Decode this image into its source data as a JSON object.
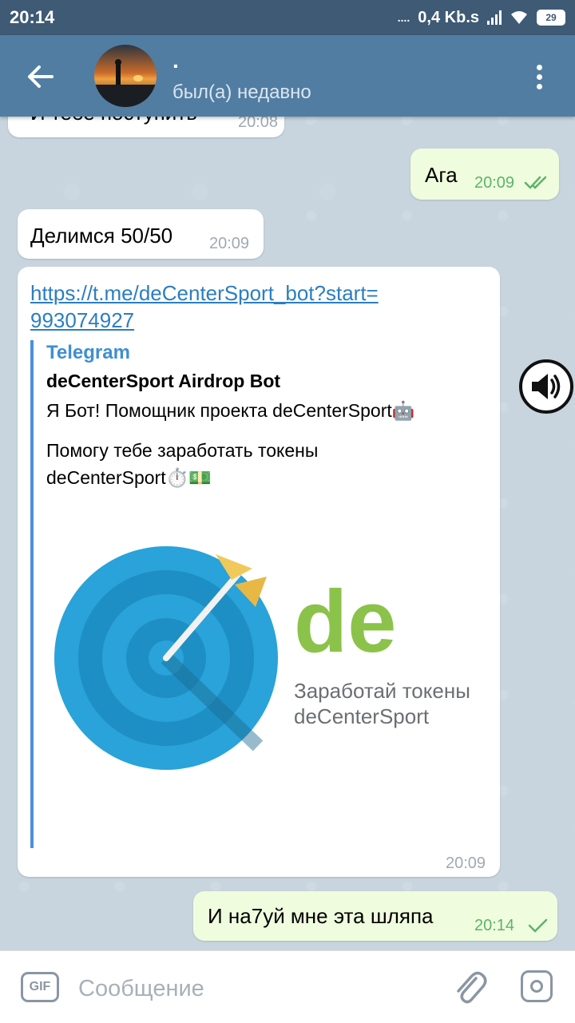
{
  "status_bar": {
    "time": "20:14",
    "dots": "....",
    "network_speed": "0,4 Kb.s",
    "battery": "29"
  },
  "header": {
    "name": ".",
    "status": "был(а) недавно"
  },
  "messages": [
    {
      "direction": "in",
      "text": "И тебе поступить",
      "time": "20:08"
    },
    {
      "direction": "out",
      "text": "Ага",
      "time": "20:09",
      "read": true
    },
    {
      "direction": "in",
      "text": "Делимся 50/50",
      "time": "20:09"
    },
    {
      "direction": "in",
      "link_line1": "https://t.me/deCenterSport_bot?start=",
      "link_line2": "993074927",
      "preview": {
        "site": "Telegram",
        "title": "deCenterSport Airdrop Bot",
        "desc1": "Я Бот! Помощник проекта deCenterSport🤖",
        "desc2": "Помогу тебе заработать токены",
        "desc3": "deCenterSport⏱️💵",
        "image_logo": "de",
        "image_caption1": "Заработай токены",
        "image_caption2": "deCenterSport"
      },
      "time": "20:09"
    },
    {
      "direction": "out",
      "text": "И на7уй мне эта шляпа",
      "time": "20:14",
      "read": false
    }
  ],
  "input": {
    "gif_label": "GIF",
    "placeholder": "Сообщение"
  },
  "colors": {
    "header": "#517da2",
    "status_bar": "#3e5a75",
    "outgoing_bubble": "#effdde",
    "link": "#2b7ec2",
    "logo_green": "#8bc34a",
    "target_blue": "#29a3d9"
  },
  "icons": [
    "back-arrow-icon",
    "more-vert-icon",
    "volume-icon",
    "double-check-icon",
    "check-icon",
    "attach-icon",
    "camera-icon",
    "signal-icon",
    "wifi-icon",
    "battery-icon"
  ]
}
